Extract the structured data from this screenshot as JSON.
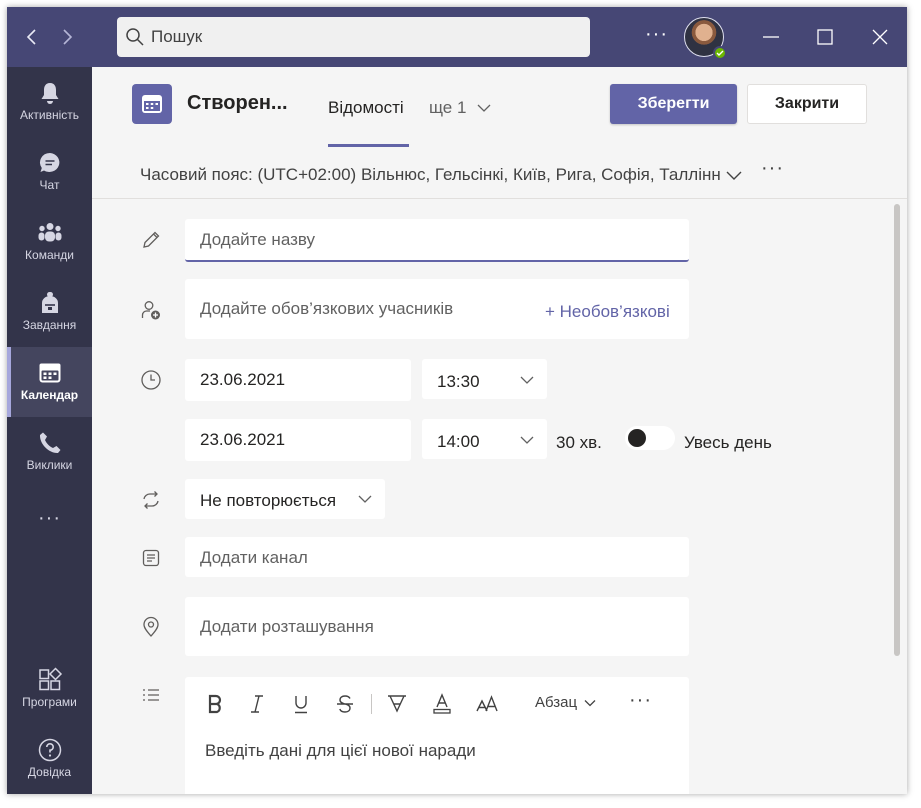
{
  "titlebar": {
    "search_placeholder": "Пошук",
    "more_label": "···"
  },
  "rail": {
    "items": [
      {
        "label": "Активність",
        "icon": "bell-icon"
      },
      {
        "label": "Чат",
        "icon": "chat-icon"
      },
      {
        "label": "Команди",
        "icon": "teams-icon"
      },
      {
        "label": "Завдання",
        "icon": "assignments-icon"
      },
      {
        "label": "Календар",
        "icon": "calendar-icon"
      },
      {
        "label": "Виклики",
        "icon": "phone-icon"
      }
    ],
    "more_label": "···",
    "apps_label": "Програми",
    "help_label": "Довідка"
  },
  "header": {
    "title": "Створен...",
    "tab_details": "Відомості",
    "tab_more": "ще 1",
    "save_label": "Зберегти",
    "close_label": "Закрити"
  },
  "timezone": {
    "text": "Часовий пояс: (UTC+02:00) Вільнюс, Гельсінкі, Київ, Рига, Софія, Таллінн",
    "more_label": "···"
  },
  "form": {
    "title_placeholder": "Додайте назву",
    "attendees_placeholder": "Додайте обов’язкових учасників",
    "optional_label": "+ Необов’язкові",
    "start_date": "23.06.2021",
    "start_time": "13:30",
    "end_date": "23.06.2021",
    "end_time": "14:00",
    "duration": "30 хв.",
    "all_day_label": "Увесь день",
    "all_day_on": false,
    "repeat_value": "Не повторюється",
    "channel_placeholder": "Додати канал",
    "location_placeholder": "Додати розташування",
    "editor_placeholder": "Введіть дані для цієї нової наради",
    "paragraph_label": "Абзац",
    "editor_more": "···"
  },
  "colors": {
    "brand": "#6264a7",
    "titlebar": "#464775",
    "rail": "#33344a",
    "presence": "#6bb700"
  }
}
